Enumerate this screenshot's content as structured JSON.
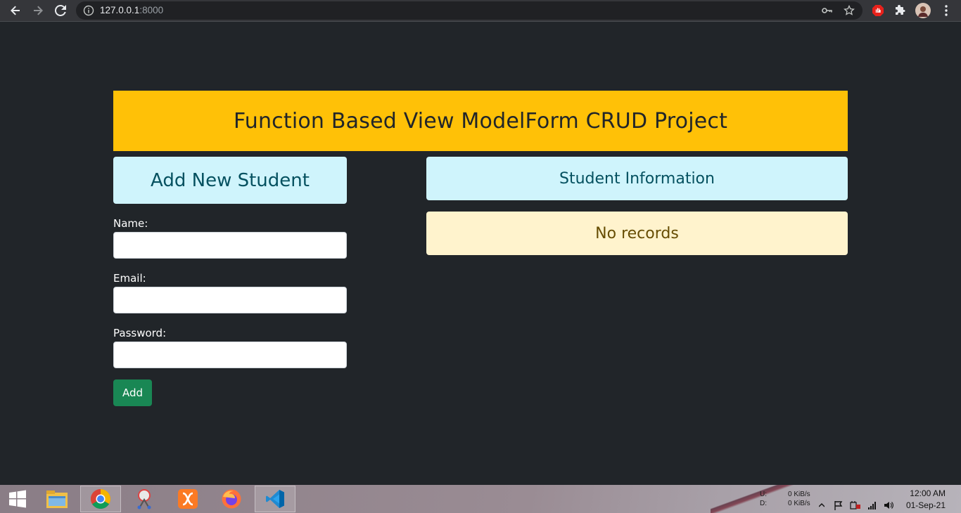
{
  "browser": {
    "url_host": "127.0.0.1",
    "url_port": ":8000",
    "icons": [
      "back-arrow-icon",
      "forward-arrow-icon",
      "reload-icon",
      "info-icon",
      "key-icon",
      "star-icon",
      "adblock-icon",
      "extensions-icon",
      "profile-avatar",
      "menu-icon"
    ]
  },
  "page": {
    "banner_title": "Function Based View ModelForm CRUD Project",
    "form_heading": "Add New Student",
    "fields": {
      "name_label": "Name:",
      "name_value": "",
      "email_label": "Email:",
      "email_value": "",
      "password_label": "Password:",
      "password_value": ""
    },
    "add_button": "Add",
    "info_heading": "Student Information",
    "no_records": "No records"
  },
  "colors": {
    "background": "#212529",
    "banner": "#ffc107",
    "info": "#cff4fc",
    "warning": "#fff3cd",
    "success": "#198754"
  },
  "taskbar": {
    "apps": [
      "start-icon",
      "file-explorer-icon",
      "chrome-icon",
      "snipping-tool-icon",
      "xampp-icon",
      "firefox-icon",
      "vscode-icon"
    ],
    "net_up_label": "U:",
    "net_down_label": "D:",
    "net_up_value": "0 KiB/s",
    "net_down_value": "0 KiB/s",
    "time": "12:00 AM",
    "date": "01-Sep-21"
  }
}
